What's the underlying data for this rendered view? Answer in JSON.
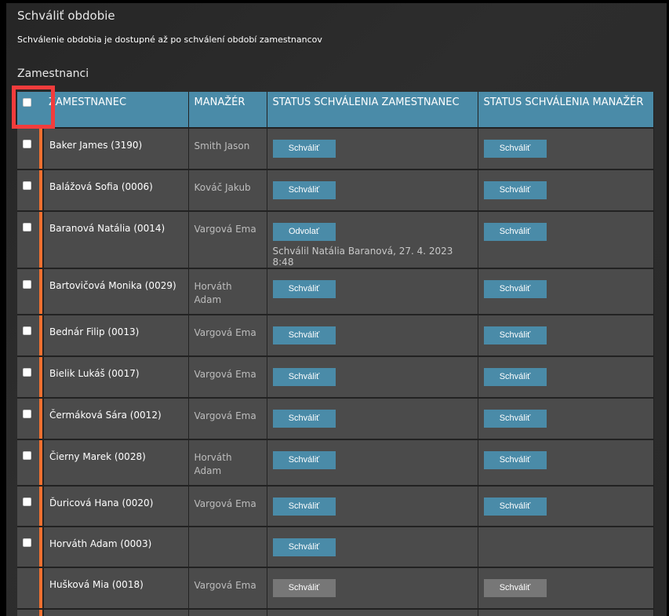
{
  "title": "Schváliť obdobie",
  "subtitle": "Schválenie obdobia je dostupné až po schválení období zamestnancov",
  "section": "Zamestnanci",
  "columns": [
    "ZAMESTNANEC",
    "MANAŽÉR",
    "STATUS SCHVÁLENIA ZAMESTNANEC",
    "STATUS SCHVÁLENIA MANAŽÉR"
  ],
  "rows": [
    {
      "name": "Baker James (3190)",
      "manager": "Smith Jason",
      "emp_btn": "Schváliť",
      "mgr_btn": "Schváliť",
      "checkbox": true
    },
    {
      "name": "Balážová Sofia (0006)",
      "manager": "Kováč Jakub",
      "emp_btn": "Schváliť",
      "mgr_btn": "Schváliť",
      "checkbox": true
    },
    {
      "name": "Baranová Natália (0014)",
      "manager": "Vargová Ema",
      "emp_btn": "Odvolať",
      "emp_note": "Schválil Natália Baranová, 27. 4. 2023 8:48",
      "mgr_btn": "Schváliť",
      "checkbox": true
    },
    {
      "name": "Bartovičová Monika (0029)",
      "manager": "Horváth Adam",
      "emp_btn": "Schváliť",
      "mgr_btn": "Schváliť",
      "checkbox": true
    },
    {
      "name": "Bednár Filip (0013)",
      "manager": "Vargová Ema",
      "emp_btn": "Schváliť",
      "mgr_btn": "Schváliť",
      "checkbox": true
    },
    {
      "name": "Bielik Lukáš (0017)",
      "manager": "Vargová Ema",
      "emp_btn": "Schváliť",
      "mgr_btn": "Schváliť",
      "checkbox": true
    },
    {
      "name": "Čermáková Sára (0012)",
      "manager": "Vargová Ema",
      "emp_btn": "Schváliť",
      "mgr_btn": "Schváliť",
      "checkbox": true
    },
    {
      "name": "Čierny Marek (0028)",
      "manager": "Horváth Adam",
      "emp_btn": "Schváliť",
      "mgr_btn": "Schváliť",
      "checkbox": true
    },
    {
      "name": "Ďuricová Hana (0020)",
      "manager": "Vargová Ema",
      "emp_btn": "Schváliť",
      "mgr_btn": "Schváliť",
      "checkbox": true
    },
    {
      "name": "Horváth Adam (0003)",
      "manager": "",
      "emp_btn": "Schváliť",
      "mgr_btn": null,
      "checkbox": true
    },
    {
      "name": "Hušková Mia (0018)",
      "manager": "Vargová Ema",
      "emp_btn": "Schváliť",
      "mgr_btn": "Schváliť",
      "checkbox": false,
      "disabled": true
    }
  ]
}
